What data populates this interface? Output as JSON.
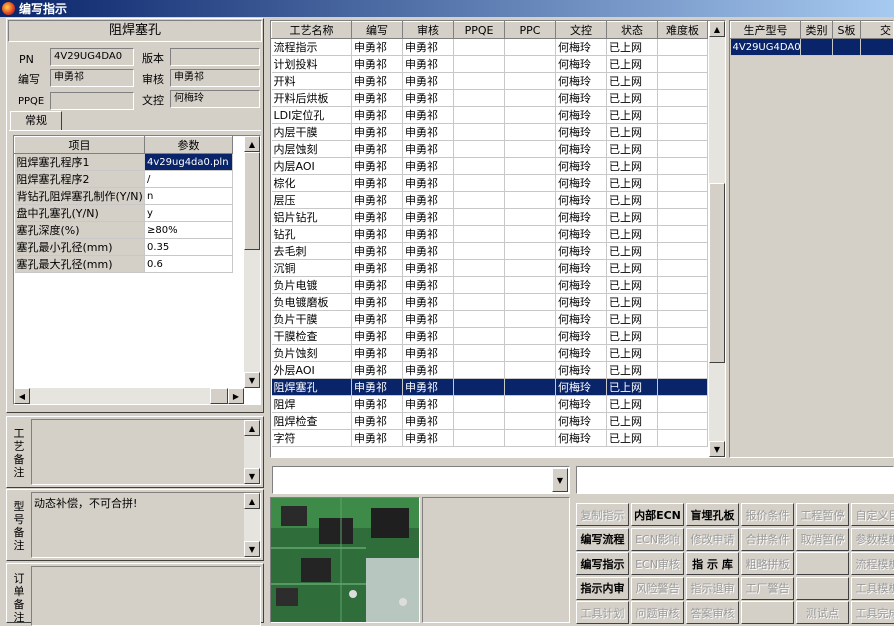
{
  "window": {
    "title": "编写指示"
  },
  "left": {
    "panel_title": "阻焊塞孔",
    "pn_label": "PN",
    "pn_value": "4V29UG4DA0",
    "version_label": "版本",
    "version_value": "",
    "author_label": "编写",
    "author_value": "申勇祁",
    "reviewer_label": "审核",
    "reviewer_value": "申勇祁",
    "ppqe_label": "PPQE",
    "ppqe_value": "",
    "doc_label": "文控",
    "doc_value": "何梅玲",
    "tab_label": "常规",
    "param_headers": [
      "项目",
      "参数"
    ],
    "params": [
      {
        "item": "阻焊塞孔程序1",
        "value": "4v29ug4da0.pln"
      },
      {
        "item": "阻焊塞孔程序2",
        "value": "/"
      },
      {
        "item": "背钻孔阻焊塞孔制作(Y/N)",
        "value": "n"
      },
      {
        "item": "盘中孔塞孔(Y/N)",
        "value": "y"
      },
      {
        "item": "塞孔深度(%)",
        "value": "≥80%"
      },
      {
        "item": "塞孔最小孔径(mm)",
        "value": "0.35"
      },
      {
        "item": "塞孔最大孔径(mm)",
        "value": "0.6"
      }
    ],
    "process_note_label": "工艺备注",
    "process_note": "",
    "model_note_label": "型号备注",
    "model_note": "动态补偿，不可合拼!",
    "order_note_label": "订单备注",
    "order_note": ""
  },
  "process_table": {
    "headers": [
      "工艺名称",
      "编写",
      "审核",
      "PPQE",
      "PPC",
      "文控",
      "状态",
      "难度板"
    ],
    "selected_index": 20,
    "rows": [
      [
        "流程指示",
        "申勇祁",
        "申勇祁",
        "",
        "",
        "何梅玲",
        "已上网",
        ""
      ],
      [
        "计划投料",
        "申勇祁",
        "申勇祁",
        "",
        "",
        "何梅玲",
        "已上网",
        ""
      ],
      [
        "开料",
        "申勇祁",
        "申勇祁",
        "",
        "",
        "何梅玲",
        "已上网",
        ""
      ],
      [
        "开料后烘板",
        "申勇祁",
        "申勇祁",
        "",
        "",
        "何梅玲",
        "已上网",
        ""
      ],
      [
        "LDI定位孔",
        "申勇祁",
        "申勇祁",
        "",
        "",
        "何梅玲",
        "已上网",
        ""
      ],
      [
        "内层干膜",
        "申勇祁",
        "申勇祁",
        "",
        "",
        "何梅玲",
        "已上网",
        ""
      ],
      [
        "内层蚀刻",
        "申勇祁",
        "申勇祁",
        "",
        "",
        "何梅玲",
        "已上网",
        ""
      ],
      [
        "内层AOI",
        "申勇祁",
        "申勇祁",
        "",
        "",
        "何梅玲",
        "已上网",
        ""
      ],
      [
        "棕化",
        "申勇祁",
        "申勇祁",
        "",
        "",
        "何梅玲",
        "已上网",
        ""
      ],
      [
        "层压",
        "申勇祁",
        "申勇祁",
        "",
        "",
        "何梅玲",
        "已上网",
        ""
      ],
      [
        "铝片钻孔",
        "申勇祁",
        "申勇祁",
        "",
        "",
        "何梅玲",
        "已上网",
        ""
      ],
      [
        "钻孔",
        "申勇祁",
        "申勇祁",
        "",
        "",
        "何梅玲",
        "已上网",
        ""
      ],
      [
        "去毛刺",
        "申勇祁",
        "申勇祁",
        "",
        "",
        "何梅玲",
        "已上网",
        ""
      ],
      [
        "沉铜",
        "申勇祁",
        "申勇祁",
        "",
        "",
        "何梅玲",
        "已上网",
        ""
      ],
      [
        "负片电镀",
        "申勇祁",
        "申勇祁",
        "",
        "",
        "何梅玲",
        "已上网",
        ""
      ],
      [
        "负电镀磨板",
        "申勇祁",
        "申勇祁",
        "",
        "",
        "何梅玲",
        "已上网",
        ""
      ],
      [
        "负片干膜",
        "申勇祁",
        "申勇祁",
        "",
        "",
        "何梅玲",
        "已上网",
        ""
      ],
      [
        "干膜检查",
        "申勇祁",
        "申勇祁",
        "",
        "",
        "何梅玲",
        "已上网",
        ""
      ],
      [
        "负片蚀刻",
        "申勇祁",
        "申勇祁",
        "",
        "",
        "何梅玲",
        "已上网",
        ""
      ],
      [
        "外层AOI",
        "申勇祁",
        "申勇祁",
        "",
        "",
        "何梅玲",
        "已上网",
        ""
      ],
      [
        "阻焊塞孔",
        "申勇祁",
        "申勇祁",
        "",
        "",
        "何梅玲",
        "已上网",
        ""
      ],
      [
        "阻焊",
        "申勇祁",
        "申勇祁",
        "",
        "",
        "何梅玲",
        "已上网",
        ""
      ],
      [
        "阻焊检查",
        "申勇祁",
        "申勇祁",
        "",
        "",
        "何梅玲",
        "已上网",
        ""
      ],
      [
        "字符",
        "申勇祁",
        "申勇祁",
        "",
        "",
        "何梅玲",
        "已上网",
        ""
      ]
    ]
  },
  "model_table": {
    "headers": [
      "生产型号",
      "类别",
      "S板",
      "交"
    ],
    "rows": [
      [
        "4V29UG4DA0",
        "",
        "",
        ""
      ]
    ]
  },
  "actions": [
    {
      "label": "复制指示",
      "enabled": false
    },
    {
      "label": "内部ECN",
      "enabled": true
    },
    {
      "label": "盲埋孔板",
      "enabled": true
    },
    {
      "label": "报价条件",
      "enabled": false
    },
    {
      "label": "工程暂停",
      "enabled": false
    },
    {
      "label": "自定义目",
      "enabled": false
    },
    {
      "label": "编写流程",
      "enabled": true
    },
    {
      "label": "ECN影响",
      "enabled": false
    },
    {
      "label": "修改申请",
      "enabled": false
    },
    {
      "label": "合拼条件",
      "enabled": false
    },
    {
      "label": "取消暂停",
      "enabled": false
    },
    {
      "label": "参数模板",
      "enabled": false
    },
    {
      "label": "编写指示",
      "enabled": true
    },
    {
      "label": "ECN审核",
      "enabled": false
    },
    {
      "label": "指 示 库",
      "enabled": true
    },
    {
      "label": "粗略拼板",
      "enabled": false
    },
    {
      "label": "",
      "enabled": false
    },
    {
      "label": "流程模板",
      "enabled": false
    },
    {
      "label": "指示内审",
      "enabled": true
    },
    {
      "label": "风险警告",
      "enabled": false
    },
    {
      "label": "指示退审",
      "enabled": false
    },
    {
      "label": "工厂警告",
      "enabled": false
    },
    {
      "label": "",
      "enabled": false
    },
    {
      "label": "工具模板",
      "enabled": false
    },
    {
      "label": "工具计划",
      "enabled": false
    },
    {
      "label": "问题审核",
      "enabled": false
    },
    {
      "label": "答案审核",
      "enabled": false
    },
    {
      "label": "",
      "enabled": false
    },
    {
      "label": "测试点",
      "enabled": false
    },
    {
      "label": "工具完成",
      "enabled": false
    }
  ],
  "icons": {
    "app": "app-icon",
    "scroll_up": "arrow-up-icon",
    "scroll_down": "arrow-down-icon",
    "scroll_left": "arrow-left-icon",
    "scroll_right": "arrow-right-icon",
    "dropdown": "chevron-down-icon"
  },
  "colors": {
    "title_start": "#0a246a",
    "title_end": "#a6caf0",
    "selection": "#0a246a",
    "face": "#d4d0c8"
  }
}
